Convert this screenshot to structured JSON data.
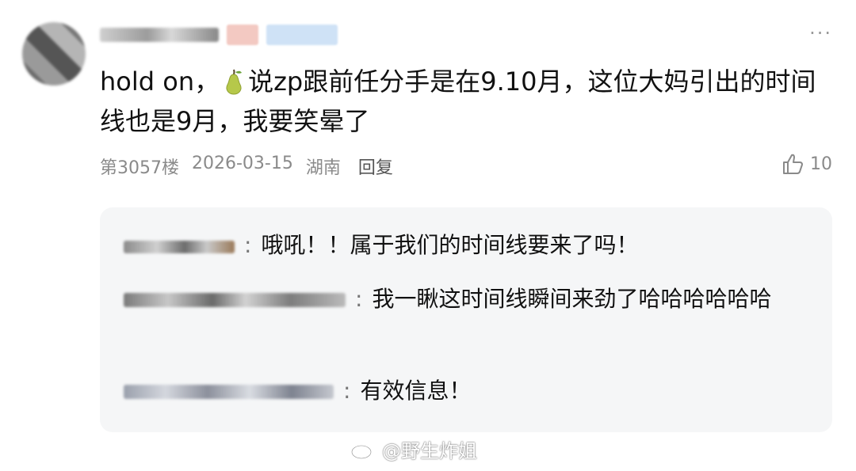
{
  "comment": {
    "more_label": "···",
    "text_before": "hold on，",
    "text_after": "说zp跟前任分手是在9.10月，这位大妈引出的时间线也是9月，我要笑晕了",
    "floor": "第3057楼",
    "date": "2026-03-15",
    "location": "湖南",
    "reply_label": "回复",
    "likes": "10"
  },
  "replies": [
    {
      "text": "哦吼！！属于我们的时间线要来了吗！"
    },
    {
      "text": "我一瞅这时间线瞬间来劲了哈哈哈哈哈哈"
    },
    {
      "text": "有效信息！"
    }
  ],
  "watermark": "@野生炸姐"
}
